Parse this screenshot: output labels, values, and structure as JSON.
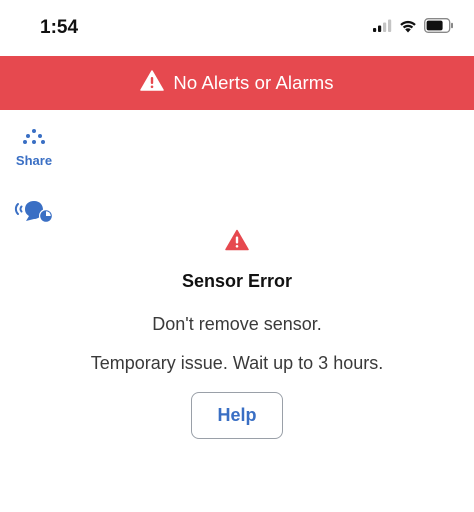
{
  "status_bar": {
    "time": "1:54",
    "icons": [
      "cellular-signal-icon",
      "wifi-icon",
      "battery-icon"
    ]
  },
  "alert_banner": {
    "icon": "warning-triangle-icon",
    "text": "No Alerts or Alarms",
    "background_color": "#e6494f"
  },
  "sidebar": {
    "share": {
      "icon": "share-dots-icon",
      "label": "Share"
    },
    "followers": {
      "icon": "followers-icon"
    }
  },
  "sensor_error": {
    "icon": "warning-triangle-icon",
    "title": "Sensor Error",
    "message_line1": "Don't remove sensor.",
    "message_line2": "Temporary issue. Wait up to 3 hours.",
    "help_label": "Help"
  },
  "colors": {
    "accent_blue": "#3a6fc4",
    "error_red": "#e6494f"
  }
}
